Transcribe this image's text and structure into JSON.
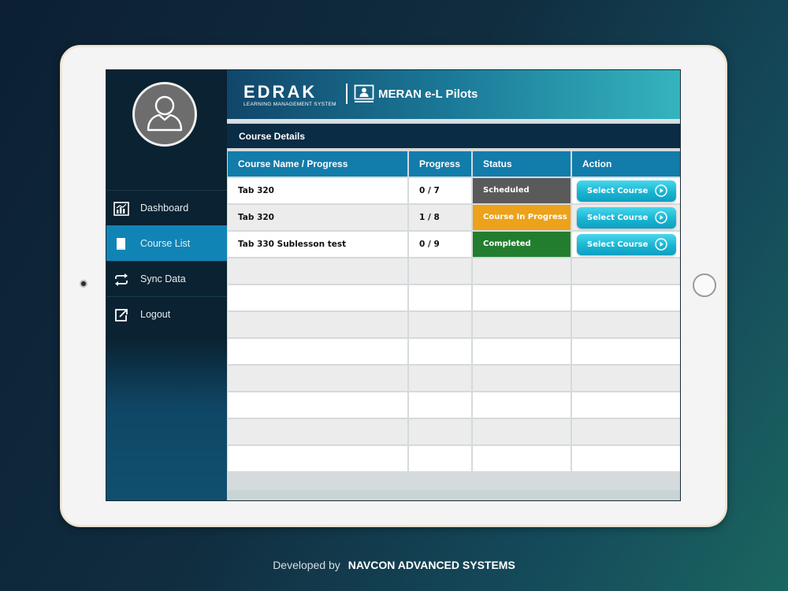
{
  "app": {
    "logo_text": "EDRAK",
    "logo_subtext": "LEARNING MANAGEMENT SYSTEM",
    "title": "MERAN e-L Pilots"
  },
  "sidebar": {
    "items": [
      {
        "label": "Dashboard",
        "icon": "bar-chart-icon"
      },
      {
        "label": "Course List",
        "icon": "book-icon",
        "active": true
      },
      {
        "label": "Sync Data",
        "icon": "sync-icon"
      },
      {
        "label": "Logout",
        "icon": "logout-icon"
      }
    ]
  },
  "section": {
    "title": "Course Details"
  },
  "table": {
    "headers": [
      "Course Name / Progress",
      "Progress",
      "Status",
      "Action"
    ],
    "rows": [
      {
        "name": "Tab 320",
        "progress": "0 / 7",
        "status": "Scheduled",
        "status_color": "#5a5a5a",
        "action": "Select Course"
      },
      {
        "name": "Tab 320",
        "progress": "1 / 8",
        "status": "Course In Progress",
        "status_color": "#eca21a",
        "action": "Select Course"
      },
      {
        "name": "Tab 330 Sublesson test",
        "progress": "0 / 9",
        "status": "Completed",
        "status_color": "#227e2e",
        "action": "Select Course"
      }
    ]
  },
  "credit": {
    "prefix": "Developed by",
    "org": "NAVCON ADVANCED SYSTEMS"
  },
  "colors": {
    "accent": "#127cab",
    "sidebar_active": "#1184b6",
    "button": "#19b5d3"
  }
}
